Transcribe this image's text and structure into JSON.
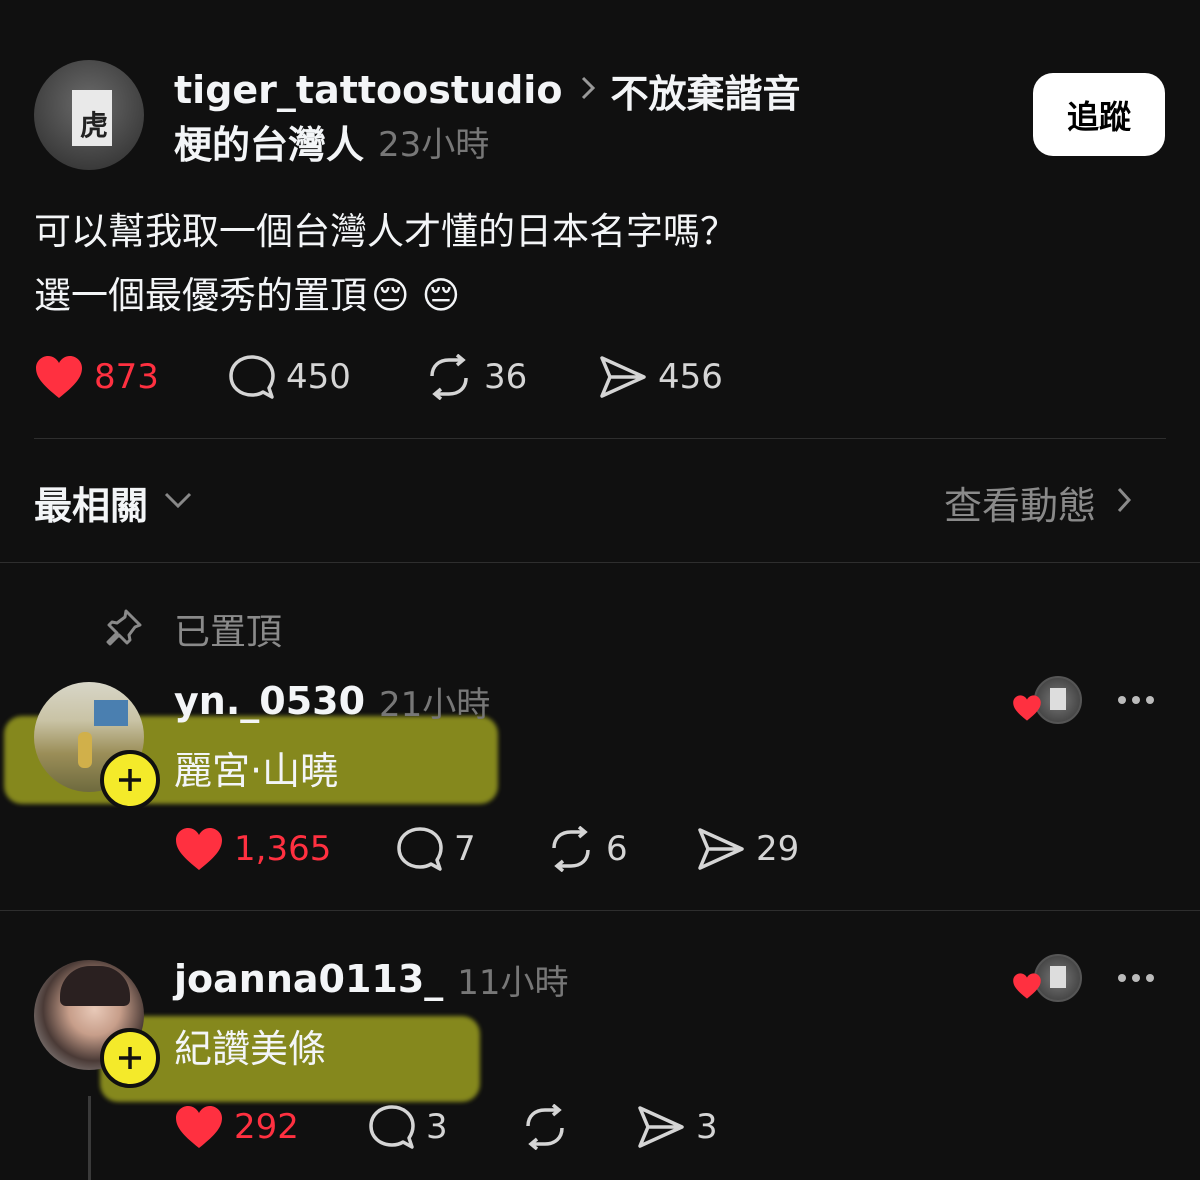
{
  "post": {
    "username": "tiger_tattoostudio",
    "community_line1": "不放棄諧音",
    "community_line2": "梗的台灣人",
    "time": "23小時",
    "follow_label": "追蹤",
    "text_line1": "可以幫我取一個台灣人才懂的日本名字嗎？",
    "text_line2": "選一個最優秀的置頂",
    "emoji_1": "😔",
    "emoji_2": "😔",
    "likes": "873",
    "comments": "450",
    "reposts": "36",
    "shares": "456"
  },
  "sort": {
    "label": "最相關",
    "activity_label": "查看動態"
  },
  "pinned_label": "已置頂",
  "replies": [
    {
      "username": "yn._0530",
      "time": "21小時",
      "text": "麗宮‧山曉",
      "likes": "1,365",
      "comments": "7",
      "reposts": "6",
      "shares": "29"
    },
    {
      "username": "joanna0113_",
      "time": "11小時",
      "text": "紀讚美條",
      "likes": "292",
      "comments": "3",
      "reposts": "",
      "shares": "3"
    }
  ],
  "colors": {
    "background": "#101010",
    "like_red": "#ff3040",
    "highlight": "#e6eb28",
    "follow_bg": "#ffffff"
  }
}
